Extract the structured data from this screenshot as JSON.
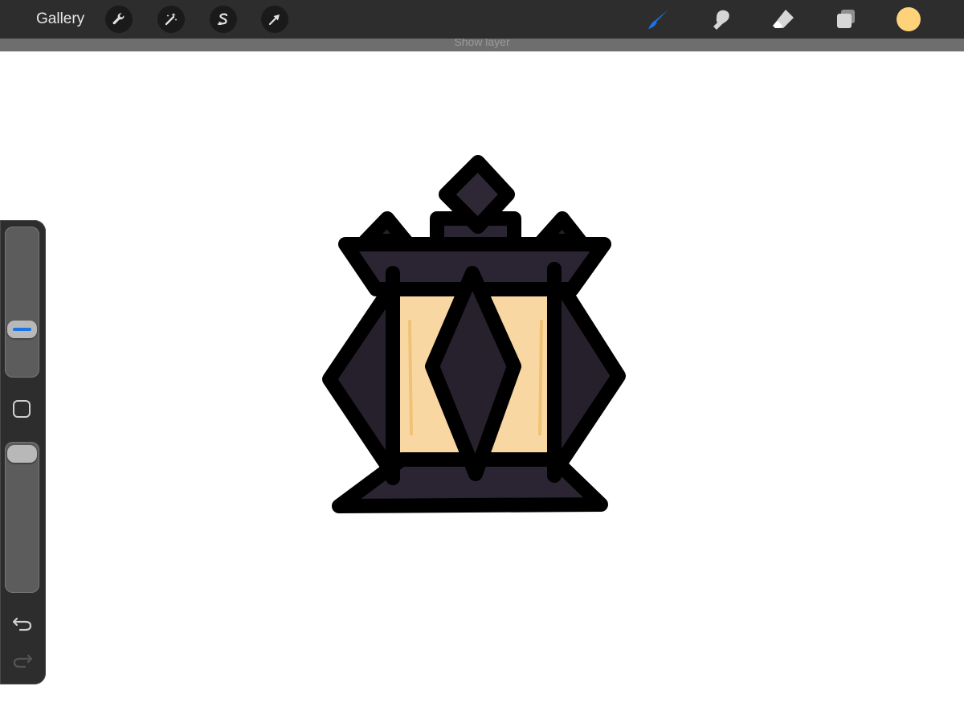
{
  "toolbar": {
    "gallery_label": "Gallery",
    "left_tools": [
      {
        "name": "actions",
        "icon": "wrench-icon"
      },
      {
        "name": "adjustments",
        "icon": "magic-wand-icon"
      },
      {
        "name": "selection",
        "icon": "selection-s-icon"
      },
      {
        "name": "transform",
        "icon": "arrow-cursor-icon"
      }
    ],
    "right_tools": [
      {
        "name": "brush",
        "icon": "brush-icon",
        "active": true
      },
      {
        "name": "smudge",
        "icon": "smudge-finger-icon",
        "active": false
      },
      {
        "name": "eraser",
        "icon": "eraser-icon",
        "active": false
      },
      {
        "name": "layers",
        "icon": "layers-icon",
        "active": false
      }
    ],
    "active_color": "#fdd27a",
    "accent_color": "#1a73e8"
  },
  "banner": {
    "text": "Show layer"
  },
  "sidebar": {
    "brush_size_level": 0.42,
    "brush_opacity_level": 1.0,
    "modify_icon": "square-icon",
    "undo_icon": "undo-icon",
    "redo_icon": "redo-icon"
  },
  "artwork": {
    "subject": "lantern-drawing",
    "body_color": "#26202c",
    "outline_color": "#000000",
    "glow_color": "#f8d7a2",
    "glow_accent": "#f0c276"
  }
}
